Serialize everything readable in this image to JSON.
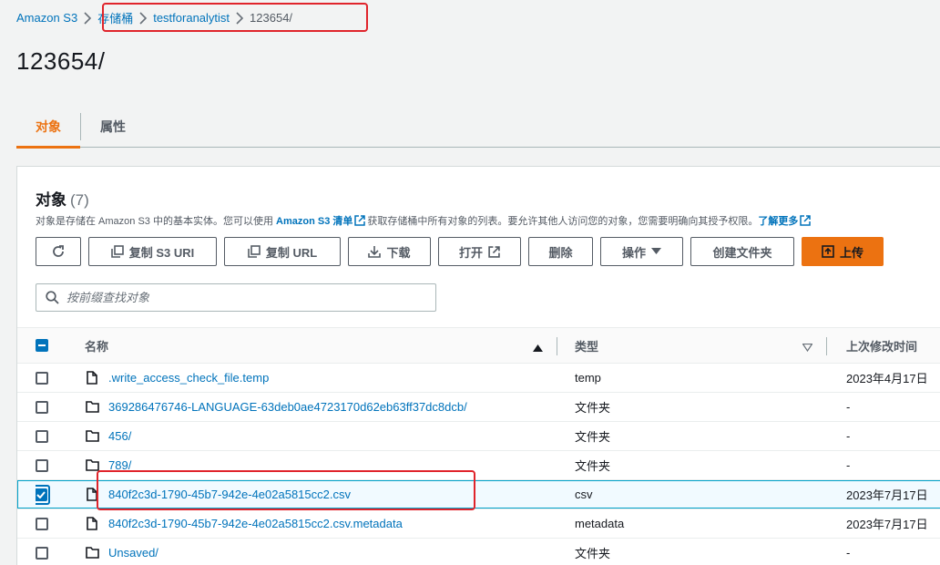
{
  "breadcrumb": {
    "root": "Amazon S3",
    "items": [
      "存储桶",
      "testforanalytist",
      "123654/"
    ]
  },
  "page": {
    "title": "123654/"
  },
  "tabs": [
    {
      "label": "对象",
      "active": true
    },
    {
      "label": "属性",
      "active": false
    }
  ],
  "panel": {
    "title": "对象",
    "count": "(7)",
    "description_pre": "对象是存储在 Amazon S3 中的基本实体。您可以使用 ",
    "description_link": "Amazon S3 清单",
    "description_mid": "获取存储桶中所有对象的列表。要允许其他人访问您的对象，您需要明确向其授予权限。",
    "learn_more": "了解更多"
  },
  "toolbar": {
    "copy_s3_uri": "复制 S3 URI",
    "copy_url": "复制 URL",
    "download": "下载",
    "open": "打开",
    "delete": "删除",
    "actions": "操作",
    "create_folder": "创建文件夹",
    "upload": "上传"
  },
  "search": {
    "placeholder": "按前缀查找对象"
  },
  "table": {
    "headers": {
      "name": "名称",
      "type": "类型",
      "modified": "上次修改时间"
    },
    "rows": [
      {
        "name": ".write_access_check_file.temp",
        "type": "temp",
        "modified": "2023年4月17日",
        "kind": "file",
        "selected": false
      },
      {
        "name": "369286476746-LANGUAGE-63deb0ae4723170d62eb63ff37dc8dcb/",
        "type": "文件夹",
        "modified": "-",
        "kind": "folder",
        "selected": false
      },
      {
        "name": "456/",
        "type": "文件夹",
        "modified": "-",
        "kind": "folder",
        "selected": false
      },
      {
        "name": "789/",
        "type": "文件夹",
        "modified": "-",
        "kind": "folder",
        "selected": false
      },
      {
        "name": "840f2c3d-1790-45b7-942e-4e02a5815cc2.csv",
        "type": "csv",
        "modified": "2023年7月17日",
        "kind": "file",
        "selected": true
      },
      {
        "name": "840f2c3d-1790-45b7-942e-4e02a5815cc2.csv.metadata",
        "type": "metadata",
        "modified": "2023年7月17日",
        "kind": "file",
        "selected": false
      },
      {
        "name": "Unsaved/",
        "type": "文件夹",
        "modified": "-",
        "kind": "folder",
        "selected": false
      }
    ]
  },
  "colors": {
    "link": "#0073bb",
    "accent": "#ec7211",
    "highlight": "#e0242b"
  }
}
